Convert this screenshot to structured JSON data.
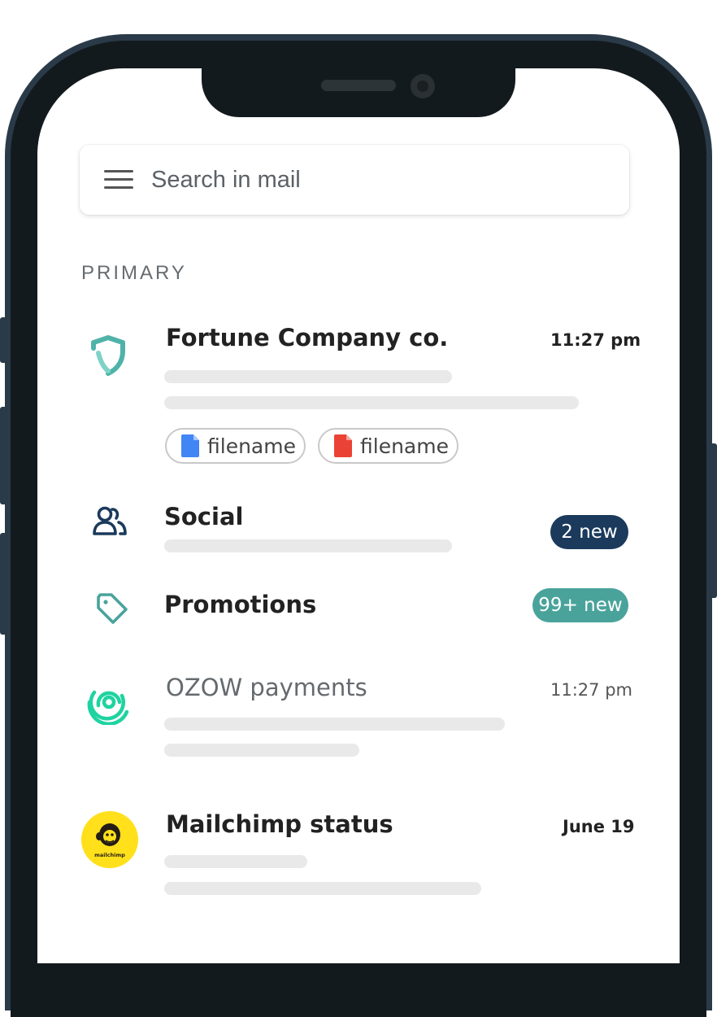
{
  "search": {
    "placeholder": "Search in mail"
  },
  "section": {
    "label": "PRIMARY"
  },
  "emails": [
    {
      "sender": "Fortune Company co.",
      "time": "11:27 pm",
      "attachments": [
        {
          "name": "filename",
          "icon": "blue-doc-icon",
          "color": "#4285f4"
        },
        {
          "name": "filename",
          "icon": "red-doc-icon",
          "color": "#ea4335"
        }
      ]
    },
    {
      "sender": "OZOW payments",
      "time": "11:27 pm"
    },
    {
      "sender": "Mailchimp status",
      "time": "June 19"
    }
  ],
  "categories": {
    "social": {
      "label": "Social",
      "badge": "2 new",
      "badge_color": "#1b3a5c"
    },
    "promotions": {
      "label": "Promotions",
      "badge": "99+ new",
      "badge_color": "#4aa39b"
    }
  },
  "colors": {
    "shield": "#4fb3a9",
    "ozow": "#1fd3a0",
    "mailchimp": "#ffe01b"
  },
  "mailchimp_logo_text": "mailchimp"
}
